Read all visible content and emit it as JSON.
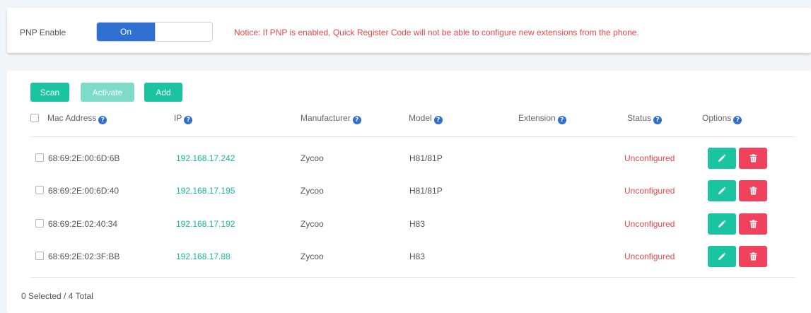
{
  "pnp": {
    "label": "PNP Enable",
    "toggle_label": "On",
    "notice": "Notice: If PNP is enabled, Quick Register Code will not be able to configure new extensions from the phone."
  },
  "toolbar": {
    "scan_label": "Scan",
    "activate_label": "Activate",
    "add_label": "Add"
  },
  "table": {
    "headers": {
      "mac": "Mac Address",
      "ip": "IP",
      "manufacturer": "Manufacturer",
      "model": "Model",
      "extension": "Extension",
      "status": "Status",
      "options": "Options"
    },
    "rows": [
      {
        "mac": "68:69:2E:00:6D:6B",
        "ip": "192.168.17.242",
        "manufacturer": "Zycoo",
        "model": "H81/81P",
        "extension": "",
        "status": "Unconfigured"
      },
      {
        "mac": "68:69:2E:00:6D:40",
        "ip": "192.168.17.195",
        "manufacturer": "Zycoo",
        "model": "H81/81P",
        "extension": "",
        "status": "Unconfigured"
      },
      {
        "mac": "68:69:2E:02:40:34",
        "ip": "192.168.17.192",
        "manufacturer": "Zycoo",
        "model": "H83",
        "extension": "",
        "status": "Unconfigured"
      },
      {
        "mac": "68:69:2E:02:3F:BB",
        "ip": "192.168.17.88",
        "manufacturer": "Zycoo",
        "model": "H83",
        "extension": "",
        "status": "Unconfigured"
      }
    ]
  },
  "footer": {
    "selection_summary": "0 Selected / 4 Total"
  },
  "colors": {
    "accent_blue": "#2f6fcf",
    "teal": "#1bc4a0",
    "danger": "#f0425c",
    "notice_red": "#e8474c"
  },
  "icons": {
    "help": "question-circle-icon",
    "edit": "pencil-icon",
    "delete": "trash-icon"
  }
}
